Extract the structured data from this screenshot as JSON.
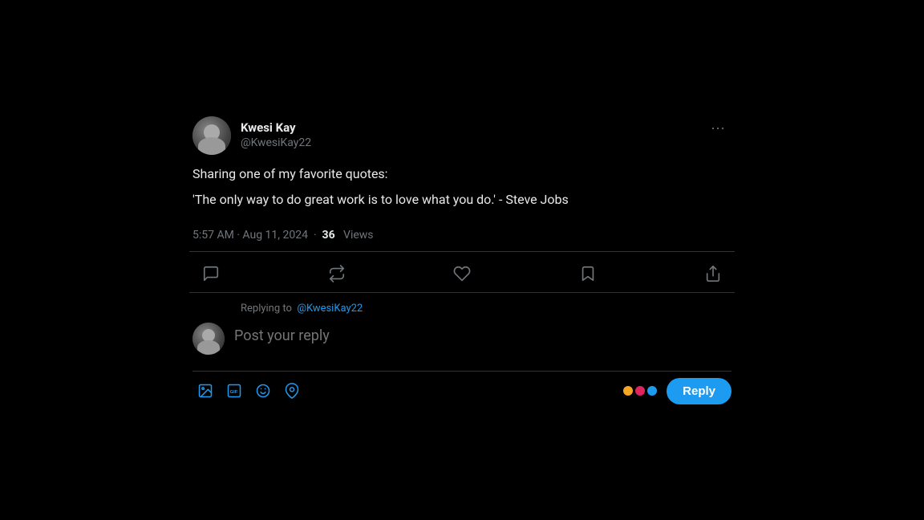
{
  "tweet": {
    "user": {
      "display_name": "Kwesi Kay",
      "username": "@KwesiKay22"
    },
    "intro": "Sharing one of my favorite quotes:",
    "quote": "'The only way to do great work is to love what you do.' - Steve Jobs",
    "timestamp": "5:57 AM · Aug 11, 2024",
    "views_count": "36",
    "views_label": "Views"
  },
  "actions": {
    "reply_label": "Reply",
    "retweet_label": "Retweet",
    "like_label": "Like",
    "bookmark_label": "Bookmark",
    "share_label": "Share"
  },
  "reply_section": {
    "replying_to_text": "Replying to",
    "replying_to_user": "@KwesiKay22",
    "placeholder": "Post your reply",
    "reply_button_label": "Reply"
  }
}
